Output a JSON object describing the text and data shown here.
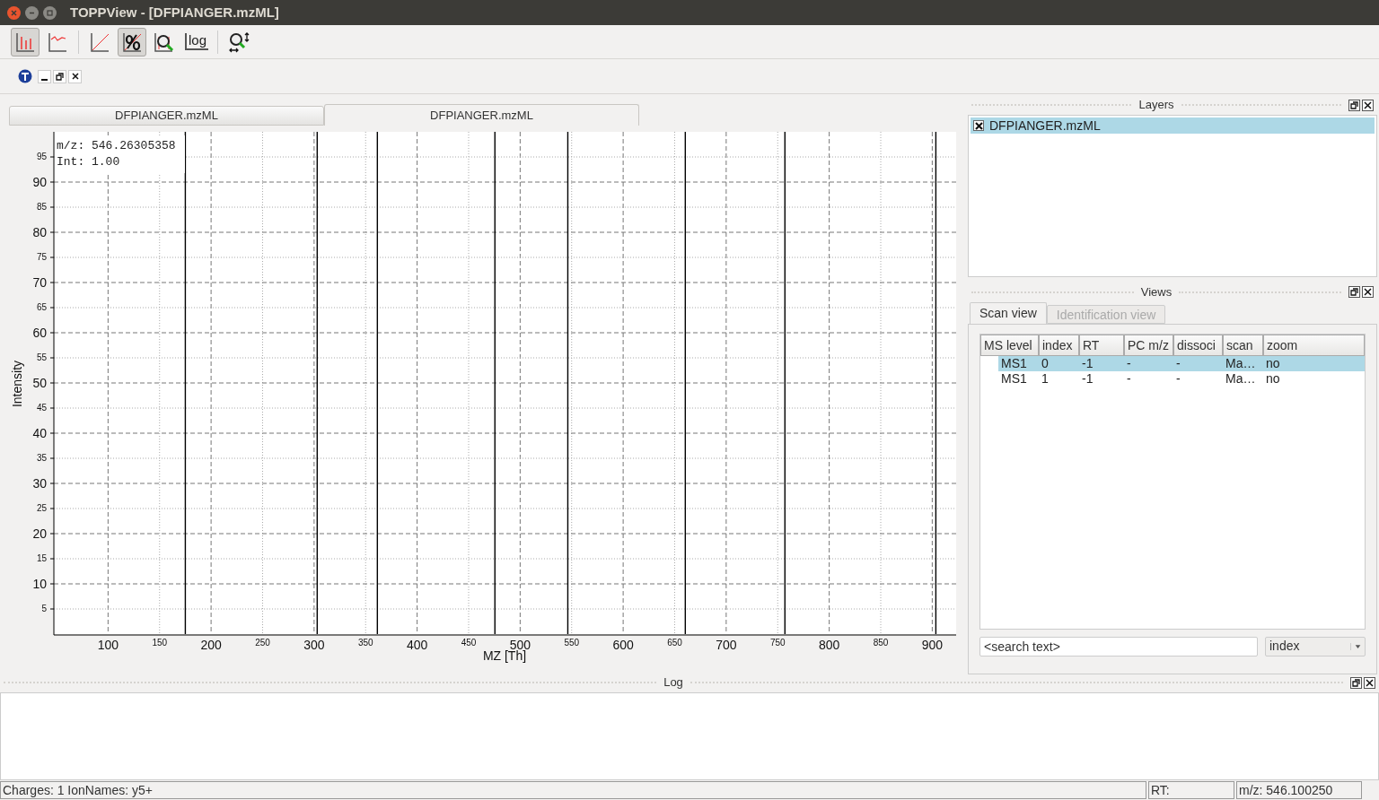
{
  "window": {
    "title": "TOPPView - [DFPIANGER.mzML]"
  },
  "toolbar": [
    {
      "kind": "sticks",
      "selected": true
    },
    {
      "kind": "profile",
      "selected": false
    },
    {
      "kind": "separator"
    },
    {
      "kind": "linear",
      "selected": false
    },
    {
      "kind": "percent",
      "selected": true
    },
    {
      "kind": "zoom",
      "selected": false
    },
    {
      "kind": "log",
      "label": "log",
      "selected": false
    },
    {
      "kind": "separator"
    },
    {
      "kind": "reset",
      "selected": false
    }
  ],
  "tabs": [
    {
      "label": "DFPIANGER.mzML",
      "selected": false
    },
    {
      "label": "DFPIANGER.mzML",
      "selected": true
    }
  ],
  "spectrum": {
    "tooltip": [
      "m/z: 546.26305358",
      "Int: 1.00"
    ],
    "chart_data": {
      "type": "bar",
      "xlabel": "MZ [Th]",
      "ylabel": "Intensity",
      "xlim": [
        47.4,
        923.2
      ],
      "ylim": [
        0,
        100
      ],
      "x": [
        175,
        303,
        361.4,
        475.5,
        546.26,
        660.3,
        757,
        903.5
      ],
      "values": [
        100,
        100,
        100,
        100,
        100,
        100,
        100,
        100
      ],
      "grid": true,
      "xticks": [
        100,
        150,
        200,
        250,
        300,
        350,
        400,
        450,
        500,
        550,
        600,
        650,
        700,
        750,
        800,
        850,
        900
      ],
      "yticks": [
        5,
        10,
        15,
        20,
        25,
        30,
        35,
        40,
        45,
        50,
        55,
        60,
        65,
        70,
        75,
        80,
        85,
        90,
        95
      ]
    }
  },
  "layers": {
    "title": "Layers",
    "items": [
      {
        "label": "DFPIANGER.mzML",
        "checked": true,
        "selected": true
      }
    ]
  },
  "views": {
    "title": "Views",
    "tabs": [
      {
        "label": "Scan view",
        "selected": true
      },
      {
        "label": "Identification view",
        "selected": false
      }
    ],
    "table": {
      "columns": [
        "MS level",
        "index",
        "RT",
        "PC m/z",
        "dissoci",
        "scan",
        "zoom"
      ],
      "rows": [
        {
          "cells": [
            "MS1",
            "0",
            "-1",
            "-",
            "-",
            "Ma…",
            "no"
          ],
          "selected": true
        },
        {
          "cells": [
            "MS1",
            "1",
            "-1",
            "-",
            "-",
            "Ma…",
            "no"
          ],
          "selected": false
        }
      ]
    },
    "search": {
      "value": "<search text>"
    },
    "dropdown": {
      "value": "index"
    }
  },
  "log": {
    "title": "Log"
  },
  "status_bar": [
    "Charges: 1 IonNames: y5+",
    "RT:",
    "m/z: 546.100250"
  ]
}
